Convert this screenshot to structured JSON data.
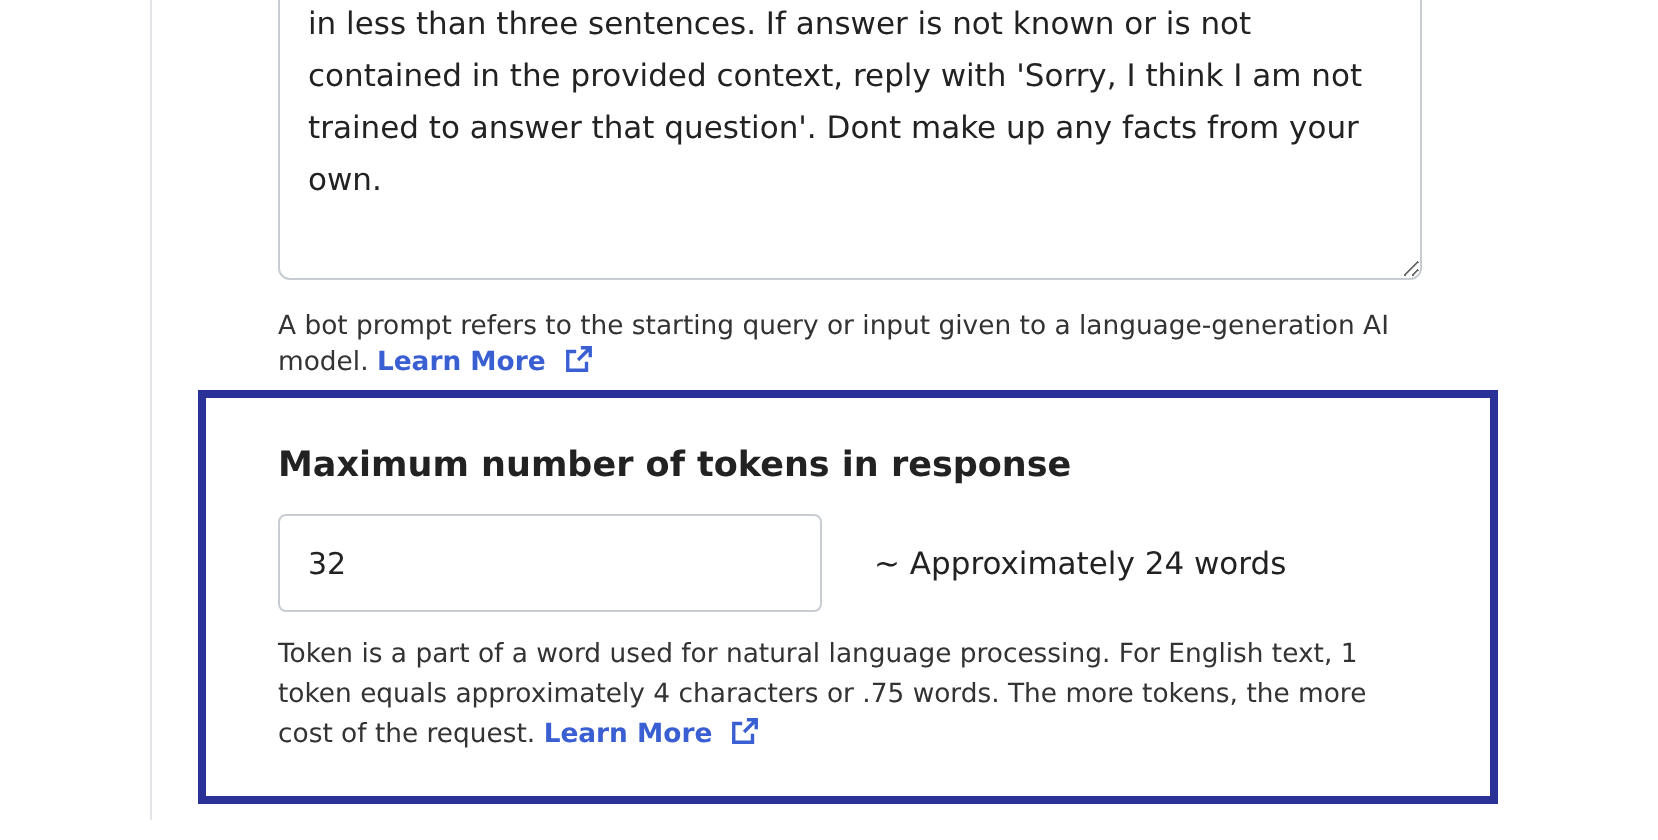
{
  "prompt_field": {
    "value": "in less than three sentences. If answer is not known or is not contained in the provided context, reply with 'Sorry, I think I am not trained to answer that question'. Dont make up any facts from your own.",
    "help": "A bot prompt refers to the starting query or input given to a language-generation AI model.",
    "link": "Learn More"
  },
  "tokens_section": {
    "title": "Maximum number of tokens in response",
    "value": "32",
    "estimate": "~ Approximately 24 words",
    "help": "Token is a part of a word used for natural language processing. For English text, 1 token equals approximately 4 characters or .75 words. The more tokens, the more cost of the request.",
    "link": "Learn More"
  }
}
